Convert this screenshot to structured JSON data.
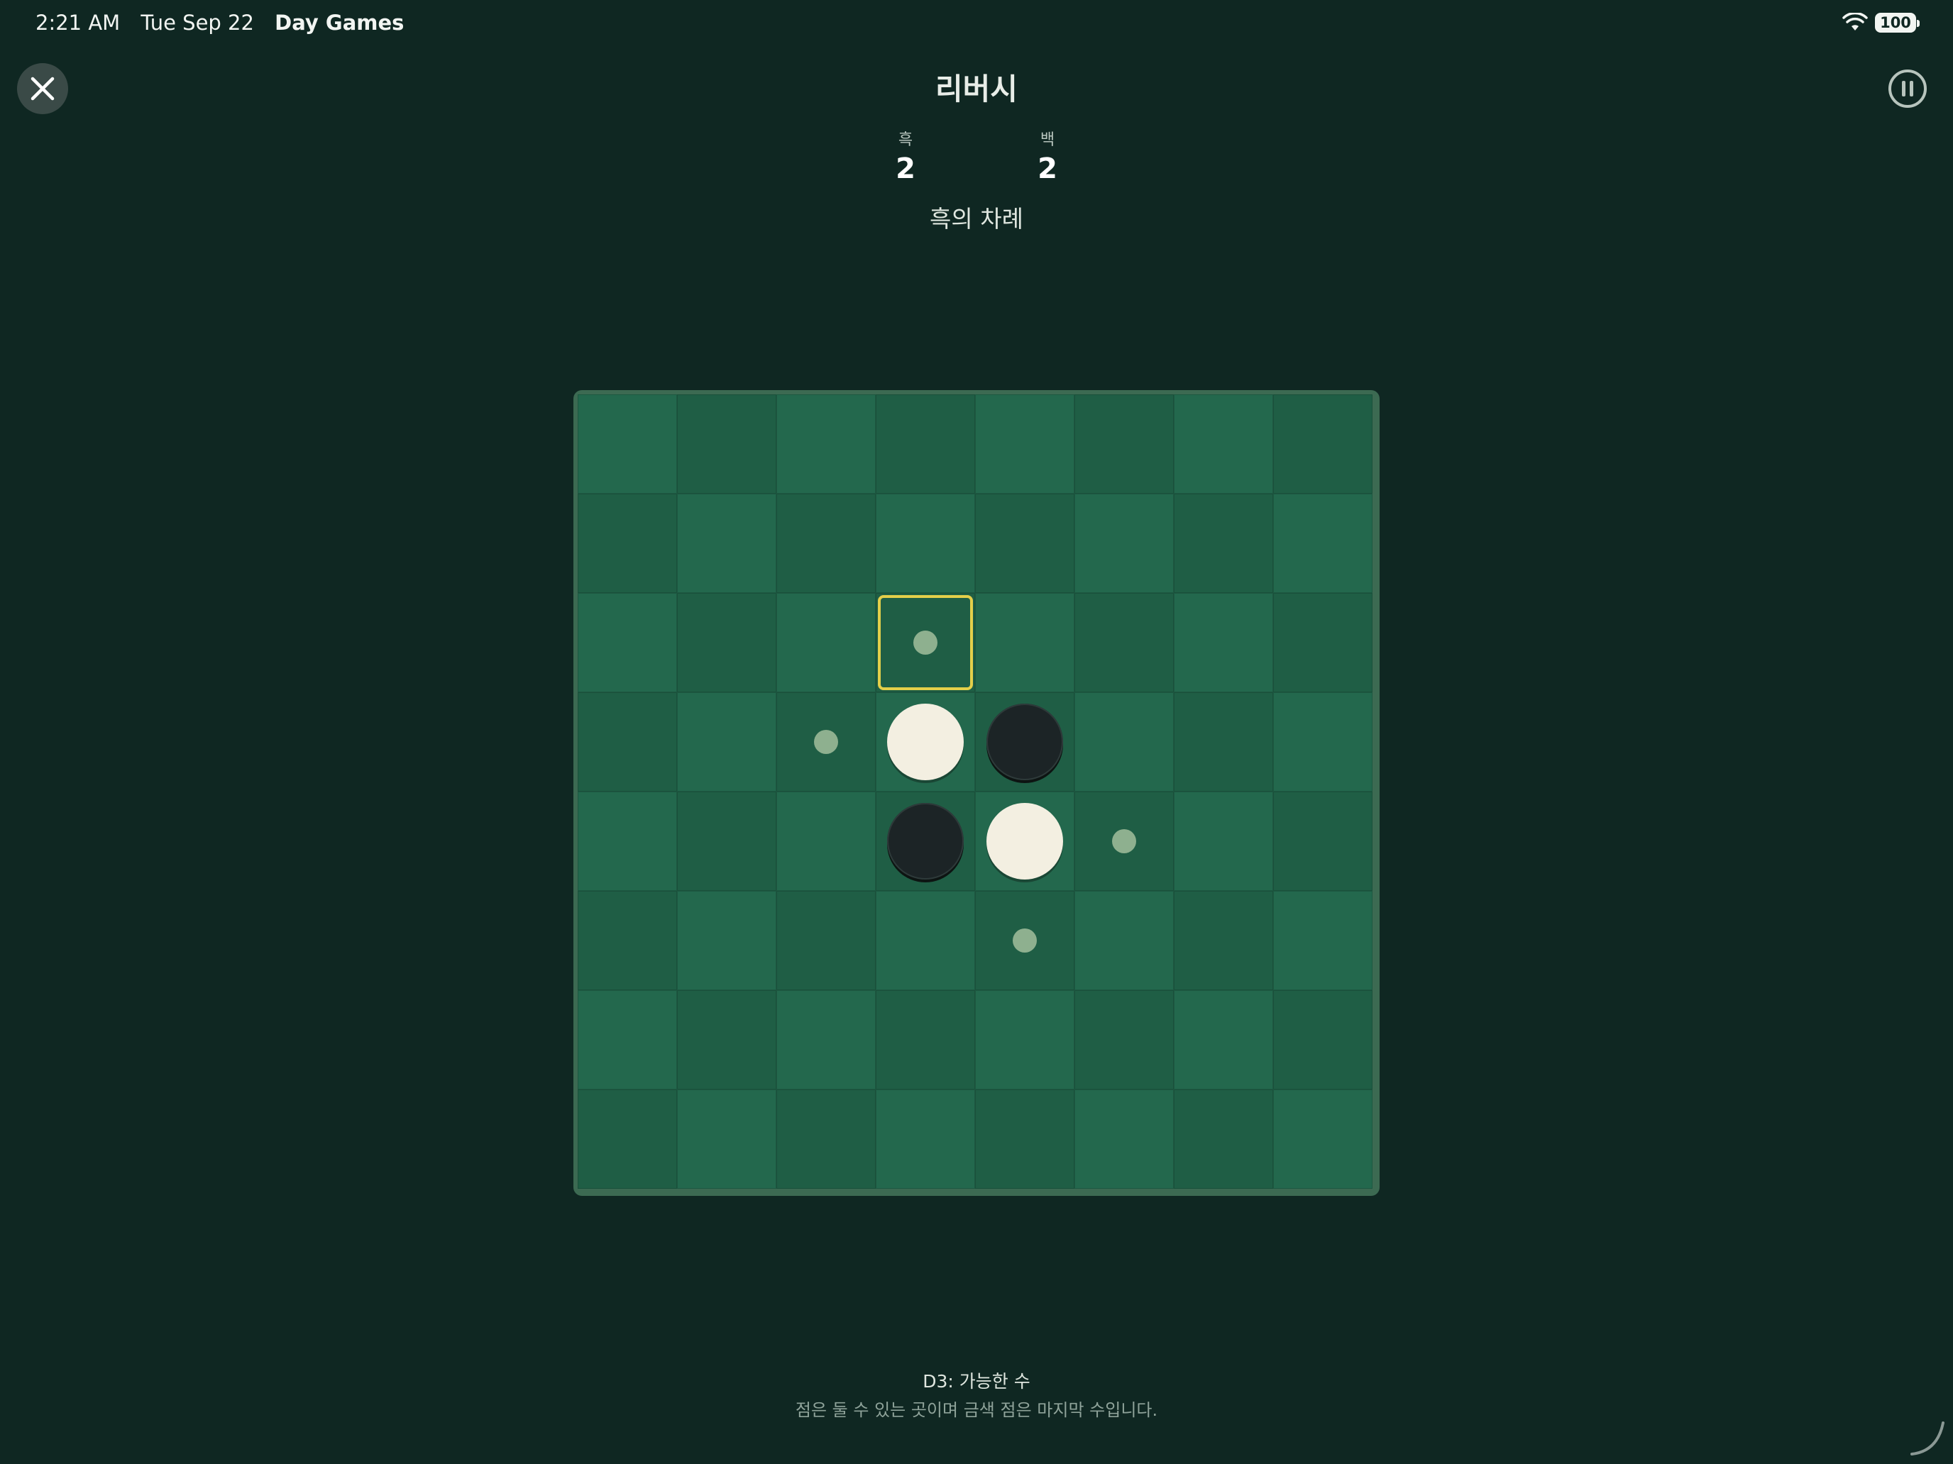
{
  "status_bar": {
    "time": "2:21 AM",
    "date": "Tue Sep 22",
    "app_name": "Day Games",
    "battery": "100"
  },
  "game": {
    "title": "리버시",
    "score": {
      "black_label": "흑",
      "black_value": "2",
      "white_label": "백",
      "white_value": "2"
    },
    "turn": "흑의 차례",
    "board": {
      "rows": 8,
      "cols": 8,
      "discs": [
        {
          "cell": "D4",
          "color": "white"
        },
        {
          "cell": "E4",
          "color": "black"
        },
        {
          "cell": "D5",
          "color": "black"
        },
        {
          "cell": "E5",
          "color": "white"
        }
      ],
      "hints": [
        "D3",
        "C4",
        "F5",
        "E6"
      ],
      "selected": "D3"
    }
  },
  "footer": {
    "selected_info": "D3: 가능한 수",
    "description": "점은 둘 수 있는 곳이며 금색 점은 마지막 수입니다."
  },
  "colors": {
    "background": "#0f2722",
    "square_light": "#23684d",
    "square_dark": "#1f5e45",
    "selection": "#e4cf4a",
    "hint": "#8eb08f"
  },
  "icons": {
    "close": "close-icon",
    "pause": "pause-icon",
    "wifi": "wifi-icon",
    "battery": "battery-icon"
  }
}
